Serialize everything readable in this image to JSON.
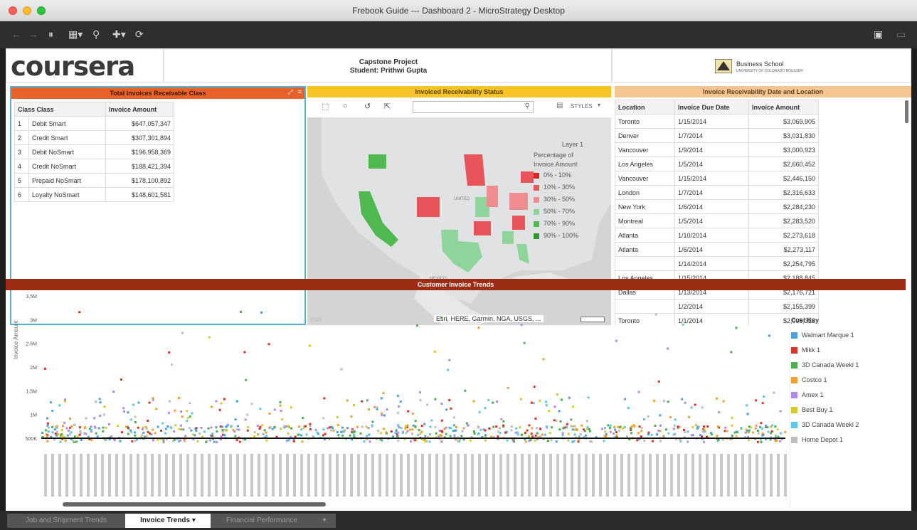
{
  "window": {
    "title": "Frebook Guide --- Dashboard 2 - MicroStrategy Desktop"
  },
  "colors": {
    "orange_header": "#e8632a",
    "yellow_header": "#f7c327",
    "peach_header": "#f6c690",
    "scatter_header": "#9c2b14",
    "selection_blue": "#56b1d6"
  },
  "header": {
    "logo": "coursera",
    "project_line1": "Capstone Project",
    "project_line2": "Student: Prithwi Gupta",
    "school": "Business School",
    "school_sub": "UNIVERSITY OF COLORADO BOULDER"
  },
  "panel_left": {
    "title": "Total Invoices Receivable Class",
    "columns": [
      "Class Class",
      "Invoice Amount"
    ],
    "rows": [
      {
        "idx": "1",
        "cls": "Debit Smart",
        "amt": "$647,057,347"
      },
      {
        "idx": "2",
        "cls": "Credit Smart",
        "amt": "$307,301,894"
      },
      {
        "idx": "3",
        "cls": "Debit NoSmart",
        "amt": "$196,958,369"
      },
      {
        "idx": "4",
        "cls": "Credit NoSmart",
        "amt": "$188,421,394"
      },
      {
        "idx": "5",
        "cls": "Prepaid NoSmart",
        "amt": "$178,100,892"
      },
      {
        "idx": "6",
        "cls": "Loyalty NoSmart",
        "amt": "$148,601,581"
      }
    ]
  },
  "panel_map": {
    "title": "Invoiced Receivability Status",
    "style_label": "STYLES",
    "legend_title": "Layer 1",
    "legend_sub1": "Percentage of",
    "legend_sub2": "Invoice Amount",
    "legend": [
      {
        "label": "0% - 10%",
        "color": "#d9262b"
      },
      {
        "label": "10% - 30%",
        "color": "#e8545a"
      },
      {
        "label": "30% - 50%",
        "color": "#ee8d8f"
      },
      {
        "label": "50% - 70%",
        "color": "#8fd49a"
      },
      {
        "label": "70% - 90%",
        "color": "#4fb84f"
      },
      {
        "label": "90% - 100%",
        "color": "#2a9a2e"
      }
    ],
    "attribution": "Esri, HERE, Garmin, NGA, USGS, ...",
    "mexico": "MEXICO",
    "credit": "esri"
  },
  "panel_right": {
    "title": "Invoice Receivability Date and Location",
    "columns": [
      "Location",
      "Invoice Due Date",
      "Invoice Amount"
    ],
    "rows": [
      {
        "loc": "Toronto",
        "date": "1/15/2014",
        "amt": "$3,069,905"
      },
      {
        "loc": "Denver",
        "date": "1/7/2014",
        "amt": "$3,031,830"
      },
      {
        "loc": "Vancouver",
        "date": "1/9/2014",
        "amt": "$3,000,923"
      },
      {
        "loc": "Los Angeles",
        "date": "1/5/2014",
        "amt": "$2,660,452"
      },
      {
        "loc": "Vancouver",
        "date": "1/15/2014",
        "amt": "$2,446,150"
      },
      {
        "loc": "London",
        "date": "1/7/2014",
        "amt": "$2,316,633"
      },
      {
        "loc": "New York",
        "date": "1/6/2014",
        "amt": "$2,284,230"
      },
      {
        "loc": "Montreal",
        "date": "1/5/2014",
        "amt": "$2,283,520"
      },
      {
        "loc": "Atlanta",
        "date": "1/10/2014",
        "amt": "$2,273,618"
      },
      {
        "loc": "Atlanta",
        "date": "1/6/2014",
        "amt": "$2,273,117"
      },
      {
        "loc": "",
        "date": "1/14/2014",
        "amt": "$2,254,795"
      },
      {
        "loc": "Los Angeles",
        "date": "1/15/2014",
        "amt": "$2,188,845"
      },
      {
        "loc": "Dallas",
        "date": "1/13/2014",
        "amt": "$2,176,721"
      },
      {
        "loc": "",
        "date": "1/2/2014",
        "amt": "$2,155,399"
      },
      {
        "loc": "Toronto",
        "date": "1/1/2014",
        "amt": "$2,099,323"
      }
    ]
  },
  "scatter": {
    "title": "Customer Invoice Trends",
    "ylabel": "Invoice Amount",
    "yticks": [
      "3.5M",
      "3M",
      "2.5M",
      "2M",
      "1.5M",
      "1M",
      "500K"
    ],
    "legend_title": "Cust Key",
    "legend": [
      {
        "label": "Walmart Marque 1",
        "color": "#4aa3df"
      },
      {
        "label": "Mikk 1",
        "color": "#d9342b"
      },
      {
        "label": "3D Canada Weekl 1",
        "color": "#4caf50"
      },
      {
        "label": "Costco 1",
        "color": "#f0a030"
      },
      {
        "label": "Amex 1",
        "color": "#b388e8"
      },
      {
        "label": "Best Buy 1",
        "color": "#d9c930"
      },
      {
        "label": "3D Canada Weekl 2",
        "color": "#5bc8e8"
      },
      {
        "label": "Home Depot 1",
        "color": "#bdbdbd"
      }
    ]
  },
  "tabs": [
    {
      "label": "Job and Shipment Trends"
    },
    {
      "label": "Invoice Trends ▾"
    },
    {
      "label": "Financial Performance"
    },
    {
      "label": "+"
    }
  ]
}
